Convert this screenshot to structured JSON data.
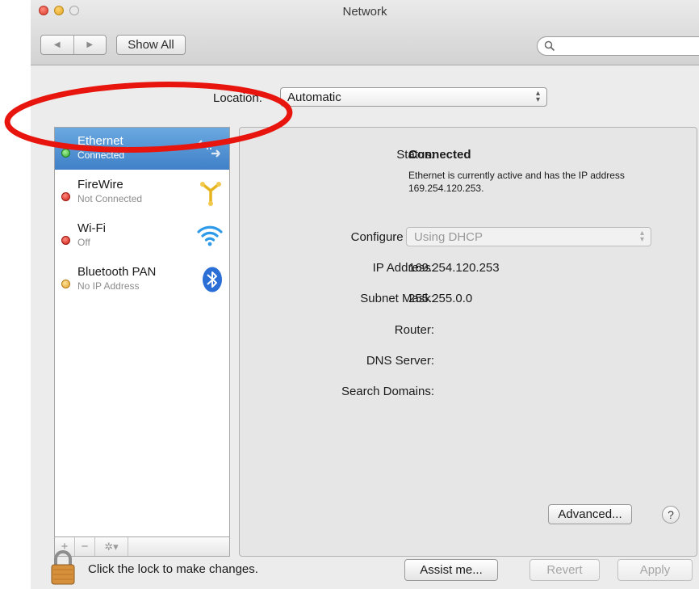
{
  "window": {
    "title": "Network"
  },
  "toolbar": {
    "back_icon": "◀",
    "forward_icon": "▶",
    "show_all_label": "Show All",
    "search_placeholder": ""
  },
  "location": {
    "label": "Location:",
    "value": "Automatic"
  },
  "sidebar": {
    "items": [
      {
        "name": "Ethernet",
        "status": "Connected",
        "dot": "green",
        "icon": "ethernet-icon",
        "selected": true
      },
      {
        "name": "FireWire",
        "status": "Not Connected",
        "dot": "red",
        "icon": "firewire-icon",
        "selected": false
      },
      {
        "name": "Wi-Fi",
        "status": "Off",
        "dot": "red",
        "icon": "wifi-icon",
        "selected": false
      },
      {
        "name": "Bluetooth PAN",
        "status": "No IP Address",
        "dot": "yellow",
        "icon": "bluetooth-icon",
        "selected": false
      }
    ],
    "add_label": "+",
    "remove_label": "−",
    "action_label": "✲▾"
  },
  "detail": {
    "status_label": "Status:",
    "status_value": "Connected",
    "status_description": "Ethernet is currently active and has the IP address 169.254.120.253.",
    "configure_label": "Configure IPv4:",
    "configure_value": "Using DHCP",
    "ip_label": "IP Address:",
    "ip_value": "169.254.120.253",
    "subnet_label": "Subnet Mask:",
    "subnet_value": "255.255.0.0",
    "router_label": "Router:",
    "router_value": "",
    "dns_label": "DNS Server:",
    "dns_value": "",
    "search_domains_label": "Search Domains:",
    "search_domains_value": "",
    "advanced_label": "Advanced...",
    "help_label": "?"
  },
  "footer": {
    "lock_text": "Click the lock to make changes.",
    "assist_label": "Assist me...",
    "revert_label": "Revert",
    "apply_label": "Apply"
  },
  "colors": {
    "annotation": "#e8150e",
    "selection": "#4a8bd0",
    "status_green": "#2ea82a",
    "status_red": "#cc1e14",
    "status_yellow": "#e3a12a"
  }
}
